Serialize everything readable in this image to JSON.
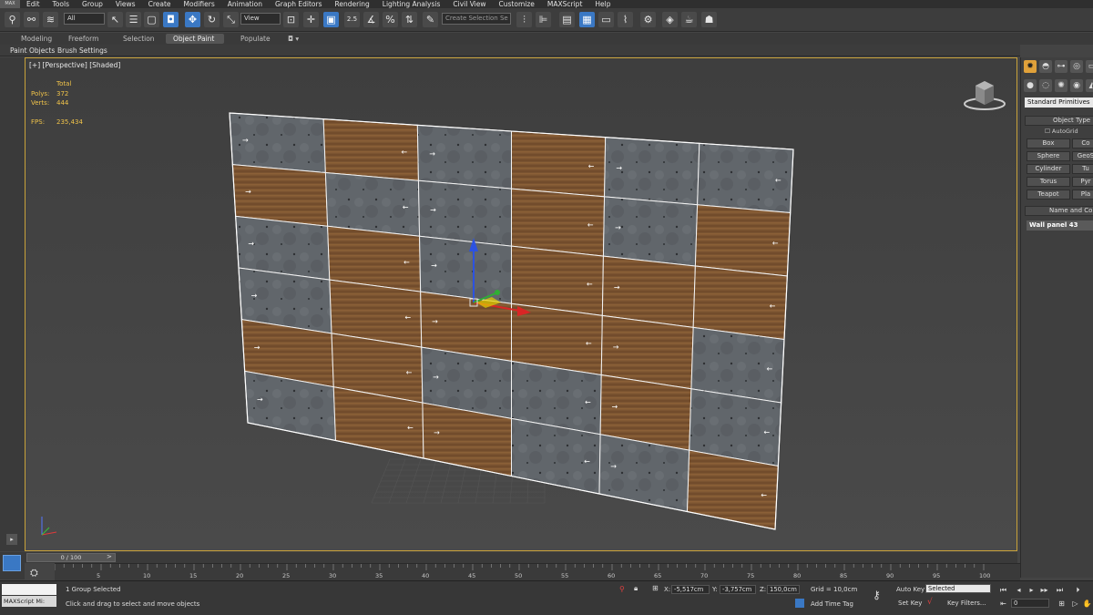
{
  "app": {
    "logo": "MAX"
  },
  "menu": [
    "Edit",
    "Tools",
    "Group",
    "Views",
    "Create",
    "Modifiers",
    "Animation",
    "Graph Editors",
    "Rendering",
    "Lighting Analysis",
    "Civil View",
    "Customize",
    "MAXScript",
    "Help"
  ],
  "toolbar": {
    "filter_value": "All",
    "refcoord_value": "View",
    "named_selection_placeholder": "Create Selection Se",
    "snap_label": "2.5",
    "angle_snap_label": "%"
  },
  "ribbon": {
    "tabs": [
      "Modeling",
      "Freeform",
      "Selection",
      "Object Paint",
      "Populate"
    ],
    "active_tab": "Object Paint",
    "sub": [
      "Paint Objects",
      "Brush Settings"
    ]
  },
  "viewport": {
    "label": "[+] [Perspective] [Shaded]",
    "stats": {
      "header": "Total",
      "polys_label": "Polys:",
      "polys_value": "372",
      "verts_label": "Verts:",
      "verts_value": "444",
      "fps_label": "FPS:",
      "fps_value": "235,434"
    }
  },
  "command_panel": {
    "category_value": "Standard Primitives",
    "object_type_header": "Object Type",
    "autogrid_label": "AutoGrid",
    "buttons": [
      "Box",
      "Co",
      "Sphere",
      "GeoS",
      "Cylinder",
      "Tu",
      "Torus",
      "Pyr",
      "Teapot",
      "Pla"
    ],
    "name_color_header": "Name and Color",
    "object_name": "Wall panel 43"
  },
  "timeline": {
    "slider_label": "0 / 100",
    "ticks": [
      "5",
      "10",
      "15",
      "20",
      "25",
      "30",
      "35",
      "40",
      "45",
      "50",
      "55",
      "60",
      "65",
      "70",
      "75",
      "80",
      "85",
      "90",
      "95",
      "100"
    ]
  },
  "status": {
    "maxscript_label": "MAXScript Mi:",
    "selection_info": "1 Group Selected",
    "prompt": "Click and drag to select and move objects",
    "x_label": "X:",
    "x_value": "-5,517cm",
    "y_label": "Y:",
    "y_value": "-3,757cm",
    "z_label": "Z:",
    "z_value": "150,0cm",
    "grid": "Grid = 10,0cm",
    "add_time_tag": "Add Time Tag",
    "auto_key": "Auto Key",
    "set_key": "Set Key",
    "selected_value": "Selected",
    "key_filters": "Key Filters...",
    "frame_value": "0"
  },
  "colors": {
    "accent_blue": "#3a78c4",
    "viewport_border": "#c8a23a",
    "stats_text": "#f0c34a",
    "concrete": "#5f6468",
    "wood": "#7a5532"
  },
  "scene": {
    "wall_rows": [
      [
        "c",
        "w",
        "c",
        "w",
        "c",
        "c"
      ],
      [
        "w",
        "c",
        "c",
        "w",
        "c",
        "w"
      ],
      [
        "c",
        "w",
        "c",
        "w",
        "w",
        "w"
      ],
      [
        "c",
        "w",
        "w",
        "w",
        "w",
        "c"
      ],
      [
        "w",
        "w",
        "c",
        "c",
        "w",
        "c"
      ],
      [
        "c",
        "w",
        "w",
        "c",
        "c",
        "w"
      ]
    ]
  }
}
